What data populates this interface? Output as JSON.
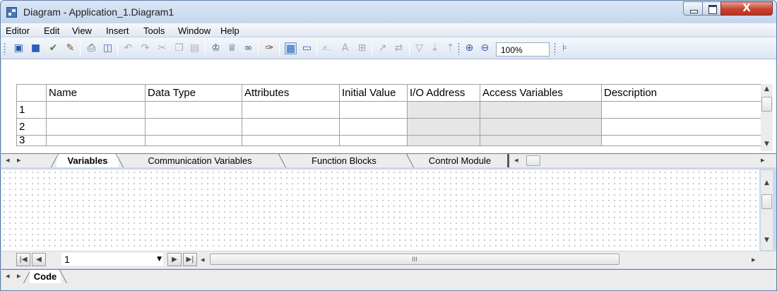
{
  "window": {
    "title": "Diagram - Application_1.Diagram1",
    "close_label": "X"
  },
  "menu": [
    "Editor",
    "Edit",
    "View",
    "Insert",
    "Tools",
    "Window",
    "Help"
  ],
  "toolbar": {
    "zoom_value": "100%",
    "icons": [
      "save-all-icon",
      "save-icon",
      "check-icon",
      "compile-icon",
      "print-icon",
      "print-preview-icon",
      "undo-icon",
      "redo-icon",
      "cut-icon",
      "copy-icon",
      "paste-icon",
      "find-icon",
      "find-next-icon",
      "binoculars-icon",
      "format-painter-icon",
      "table-view-icon",
      "panel-view-icon",
      "if-then-icon",
      "text-style-icon",
      "insert-block-icon",
      "link-icon",
      "replace-icon",
      "filter-icon",
      "sort-ascending-icon",
      "sort-descending-icon",
      "zoom-in-icon",
      "zoom-out-icon"
    ]
  },
  "grid": {
    "columns": [
      "Name",
      "Data Type",
      "Attributes",
      "Initial Value",
      "I/O Address",
      "Access Variables",
      "Description"
    ],
    "rows": [
      "1",
      "2",
      "3"
    ]
  },
  "variable_tabs": [
    "Variables",
    "Communication Variables",
    "Function Blocks",
    "Control Module"
  ],
  "code_tabs": [
    "Code"
  ],
  "navigator": {
    "page_value": "1",
    "scroll_marker": "III"
  }
}
